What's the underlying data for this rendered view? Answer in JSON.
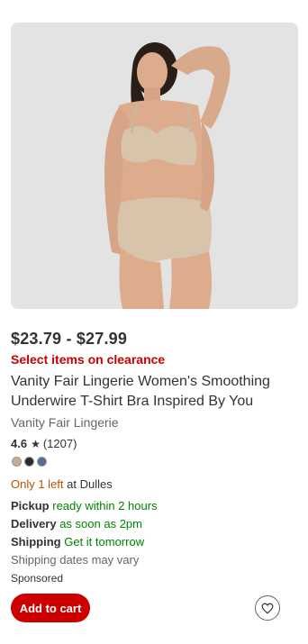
{
  "product": {
    "image_alt": "Vanity Fair Lingerie Women's Smoothing Underwire T-Shirt Bra",
    "price_range": "$23.79 - $27.99",
    "clearance_text": "Select items on clearance",
    "title": "Vanity Fair Lingerie Women's Smoothing Underwire T-Shirt Bra Inspired By You",
    "brand": "Vanity Fair Lingerie",
    "rating": {
      "score": "4.6",
      "count": "(1207)"
    },
    "swatches": [
      {
        "color": "#c8ab94"
      },
      {
        "color": "#2b2b2b"
      },
      {
        "color": "#556b9a"
      }
    ]
  },
  "availability": {
    "stock_prefix": "Only 1 left",
    "stock_suffix": " at Dulles",
    "pickup_label": "Pickup",
    "pickup_value": " ready within 2 hours",
    "delivery_label": "Delivery",
    "delivery_value": " as soon as 2pm",
    "shipping_label": "Shipping",
    "shipping_value": " Get it tomorrow",
    "shipping_note": "Shipping dates may vary"
  },
  "sponsored_label": "Sponsored",
  "actions": {
    "add_to_cart_label": "Add to cart"
  },
  "colors": {
    "accent_red": "#cc0000",
    "stock_orange": "#b85300",
    "fulfillment_green": "#008300"
  },
  "icons": {
    "rating_star": "star-icon",
    "favorite": "heart-icon"
  }
}
